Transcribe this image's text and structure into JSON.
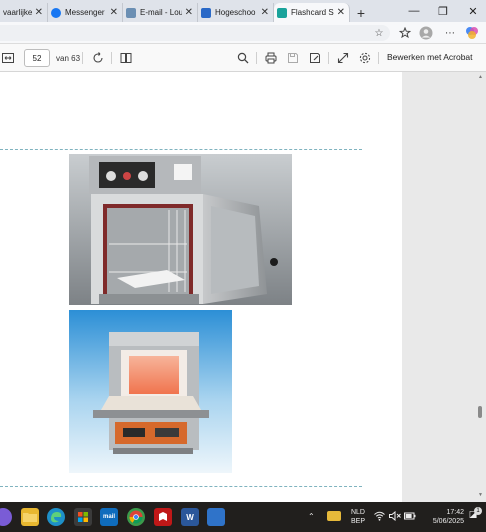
{
  "tabs": [
    {
      "label": "vaarlijke",
      "favicon": "document-icon",
      "color": "#3a6ea5"
    },
    {
      "label": "Messenger",
      "favicon": "messenger-icon",
      "color": "#1877f2"
    },
    {
      "label": "E-mail - Lou",
      "favicon": "outlook-mail-icon",
      "color": "#6b8fb3"
    },
    {
      "label": "Hogeschoo",
      "favicon": "hogeschool-icon",
      "color": "#2a69c7"
    },
    {
      "label": "Flashcard Se",
      "favicon": "flashcard-icon",
      "color": "#1aa39b"
    }
  ],
  "tab_close_glyph": "✕",
  "new_tab_glyph": "+",
  "window_controls": {
    "minimize": "—",
    "maximize": "❐",
    "close": "✕"
  },
  "pdf": {
    "page_current": "52",
    "page_total": "van 63",
    "acrobat_label": "Bewerken met Acrobat"
  },
  "taskbar": {
    "language": "NLD",
    "layout": "BEP",
    "time": "17:42",
    "date": "5/06/2025",
    "notification_count": "1",
    "apps": [
      {
        "name": "copilot-icon",
        "color": "#7a5cd6",
        "label": ""
      },
      {
        "name": "file-explorer-icon",
        "color": "#e8b730",
        "label": ""
      },
      {
        "name": "edge-icon",
        "color": "#1e90c8",
        "label": ""
      },
      {
        "name": "store-icon",
        "color": "#3b3b3b",
        "label": ""
      },
      {
        "name": "mail-icon",
        "color": "#0f6cbd",
        "label": "mail"
      },
      {
        "name": "chrome-icon",
        "color": "#3b9b4b",
        "label": ""
      },
      {
        "name": "mcafee-icon",
        "color": "#c01818",
        "label": ""
      },
      {
        "name": "word-icon",
        "color": "#2b579a",
        "label": "W"
      },
      {
        "name": "pinned-app-icon",
        "color": "#2f73c9",
        "label": ""
      }
    ]
  },
  "colors": {
    "page_bg": "#ffffff",
    "viewer_bg": "#e9e9e9",
    "dash_rule": "#7fb3bf",
    "taskbar_bg": "#211f1d"
  }
}
